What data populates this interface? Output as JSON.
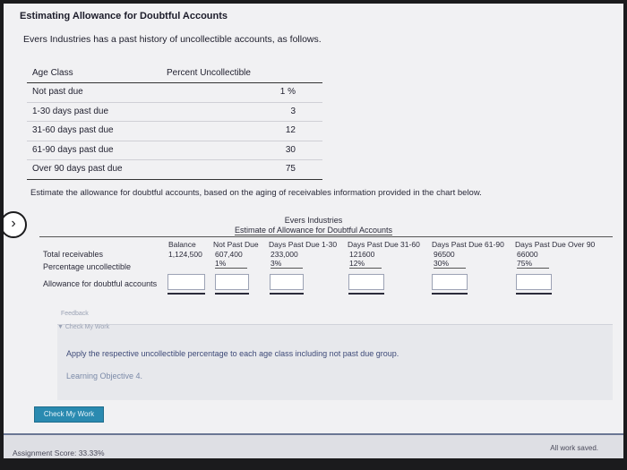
{
  "title": "Estimating Allowance for Doubtful Accounts",
  "intro": "Evers Industries has a past history of uncollectible accounts, as follows.",
  "age_table": {
    "headers": [
      "Age Class",
      "Percent Uncollectible"
    ],
    "rows": [
      {
        "age": "Not past due",
        "percent": "1 %"
      },
      {
        "age": "1-30 days past due",
        "percent": "3"
      },
      {
        "age": "31-60 days past due",
        "percent": "12"
      },
      {
        "age": "61-90 days past due",
        "percent": "30"
      },
      {
        "age": "Over 90 days past due",
        "percent": "75"
      }
    ]
  },
  "instruction": "Estimate the allowance for doubtful accounts, based on the aging of receivables information provided in the chart below.",
  "estimate": {
    "company": "Evers Industries",
    "subtitle": "Estimate of Allowance for Doubtful Accounts",
    "row_labels": [
      "Total receivables",
      "Percentage uncollectible",
      "Allowance for doubtful accounts"
    ],
    "columns": [
      {
        "header": "Balance",
        "total": "1,124,500",
        "pct": ""
      },
      {
        "header": "Not Past Due",
        "total": "607,400",
        "pct": "1%"
      },
      {
        "header": "Days Past Due 1-30",
        "total": "233,000",
        "pct": "3%"
      },
      {
        "header": "Days Past Due 31-60",
        "total": "121600",
        "pct": "12%"
      },
      {
        "header": "Days Past Due 61-90",
        "total": "96500",
        "pct": "30%"
      },
      {
        "header": "Days Past Due Over 90",
        "total": "66000",
        "pct": "75%"
      }
    ]
  },
  "feedback": {
    "label": "Feedback",
    "check_label": "▼ Check My Work",
    "text": "Apply the respective uncollectible percentage to each age class including not past due group.",
    "learning_objective": "Learning Objective 4."
  },
  "check_button": "Check My Work",
  "footer": {
    "score": "Assignment Score: 33.33%",
    "saved": "All work saved."
  }
}
